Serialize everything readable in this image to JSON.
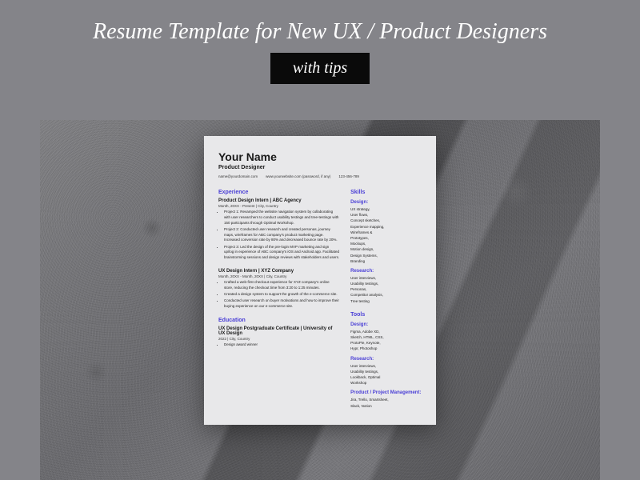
{
  "header": {
    "title": "Resume Template for New UX / Product Designers",
    "badge": "with tips"
  },
  "resume": {
    "name": "Your Name",
    "role": "Product Designer",
    "contact": {
      "email": "name@yourdomain.com",
      "site": "www.yourwebsite.com (password, if any)",
      "phone": "123-456-789"
    },
    "experience": {
      "heading": "Experience",
      "jobs": [
        {
          "title": "Product Design Intern | ABC Agency",
          "meta": "Month, 20XX - Present | City, Country",
          "bullets": [
            "Project 1: Revamped the website navigation system by collaborating with user researchers to conduct usability testings and tree-testings with 150 participants through Optimal Workshop.",
            "Project 2: Conducted user research and created personas, journey maps, wireframes for ABC company's product marketing page. Increased conversion rate by 80% and decreased bounce rate by 20%.",
            "Project 3: Led the design of the pre-login MVP marketing and sign up/log in experience of ABC company's iOS and Android app. Facilitated brainstorming sessions and design reviews with stakeholders and users."
          ]
        },
        {
          "title": "UX Design Intern | XYZ Company",
          "meta": "Month, 20XX - Month, 20XX | City, Country",
          "bullets": [
            "Crafted a web-first checkout experience for XYZ company's online store, reducing the checkout time from 3:20 to 1:25 minutes.",
            "Created a design system to support the growth of the e-commerce site.",
            "Conducted user research on buyer motivations and how to improve their buying experience on our e-commerce site."
          ]
        }
      ]
    },
    "education": {
      "heading": "Education",
      "degree": "UX Design Postgraduate Certificate | University of UX Design",
      "meta": "2022 | City, Country",
      "bullets": [
        "Design award winner"
      ]
    },
    "skills": {
      "heading": "Skills",
      "design": {
        "heading": "Design:",
        "items": "UX strategy,\nUser flows,\nConcept sketches,\nExperience mapping,\nWireframes &\nPrototypes,\nMockups,\nMotion design,\nDesign Systems,\nBranding"
      },
      "research": {
        "heading": "Research:",
        "items": "User interviews,\nUsability testings,\nPersonas,\nCompetitor analysis,\nTree testing"
      }
    },
    "tools": {
      "heading": "Tools",
      "design": {
        "heading": "Design:",
        "items": "Figma, Adobe XD,\nSketch, HTML, CSS,\nProtoPie, Keynote,\nHypr, Photoshop"
      },
      "research": {
        "heading": "Research:",
        "items": "User interviews,\nUsability testings,\nLookback, Optimal\nWorkshop"
      },
      "pm": {
        "heading": "Product / Project Management:",
        "items": "Jira, Trello, Smartsheet,\nSlack, Notion"
      }
    }
  }
}
